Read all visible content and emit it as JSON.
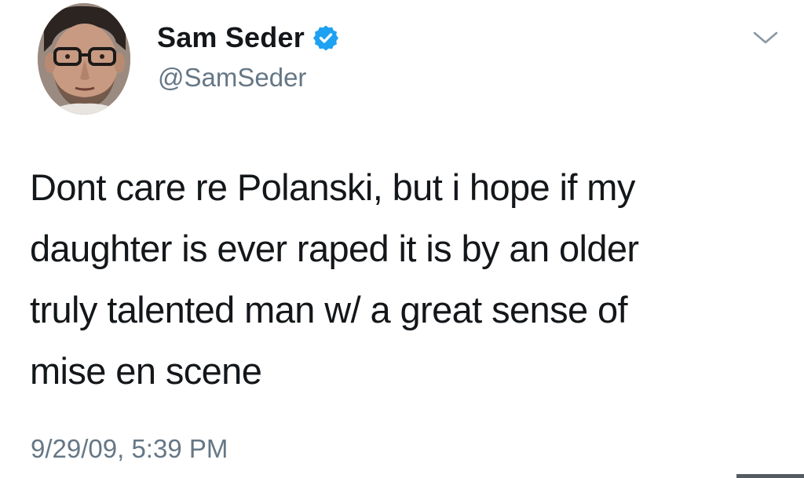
{
  "tweet": {
    "author": {
      "display_name": "Sam Seder",
      "handle": "@SamSeder",
      "verified": true
    },
    "text": "Dont care re Polanski, but i hope if my\ndaughter is ever raped it is by an older\ntruly talented man w/ a great sense of\nmise en scene",
    "timestamp": "9/29/09, 5:39 PM"
  },
  "icons": {
    "verified": "verified-badge-icon",
    "menu": "chevron-down-icon"
  },
  "colors": {
    "primary_text": "#14171a",
    "secondary_text": "#657786",
    "verified_blue": "#1da1f2",
    "background": "#ffffff"
  }
}
